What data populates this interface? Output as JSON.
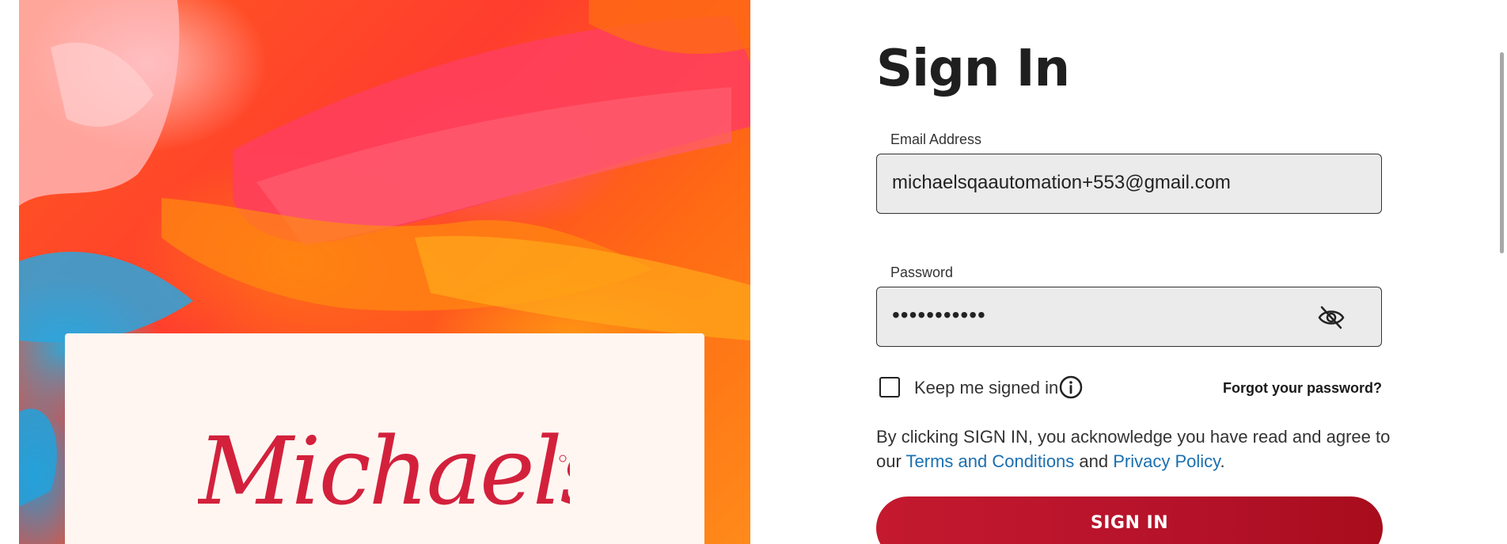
{
  "brand": {
    "logo_text": "Michaels",
    "logo_color": "#d3213c"
  },
  "form": {
    "title": "Sign In",
    "email": {
      "label": "Email Address",
      "value": "michaelsqaautomation+553@gmail.com"
    },
    "password": {
      "label": "Password",
      "masked_value": "•••••••••••",
      "toggle_icon": "eye-slash-icon"
    },
    "keep_signed_in": {
      "label": "Keep me signed in",
      "checked": false,
      "info_icon": "info-icon"
    },
    "forgot_password": "Forgot your password?",
    "legal": {
      "prefix": "By clicking SIGN IN, you acknowledge you have read and agree to our ",
      "terms_link": "Terms and Conditions",
      "middle": " and ",
      "privacy_link": "Privacy Policy",
      "suffix": "."
    },
    "submit_label": "SIGN IN"
  },
  "colors": {
    "accent": "#c4192f",
    "link": "#1a6fb0",
    "field_bg": "#ebebeb"
  }
}
